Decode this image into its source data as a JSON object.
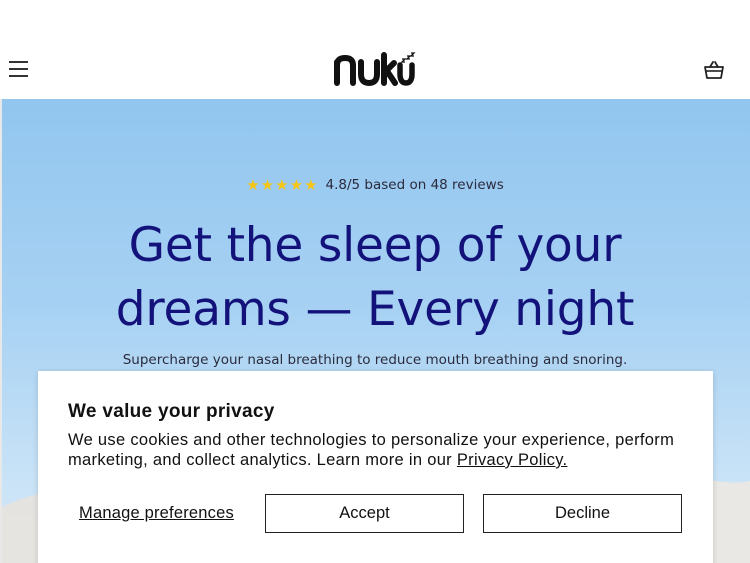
{
  "header": {
    "menu_icon": "hamburger-icon",
    "logo_text": "nukü",
    "cart_icon": "basket-icon"
  },
  "hero": {
    "rating": {
      "stars": 5,
      "star_icon": "star-icon",
      "text": "4.8/5 based on 48 reviews"
    },
    "headline_line1": "Get the sleep of your",
    "headline_line2": "dreams — Every night",
    "subline": "Supercharge your nasal breathing to reduce mouth breathing and snoring."
  },
  "cookie_banner": {
    "title": "We value your privacy",
    "body_text": "We use cookies and other technologies to personalize your experience, perform marketing, and collect analytics. Learn more in our ",
    "policy_link": "Privacy Policy.",
    "manage_label": "Manage preferences",
    "accept_label": "Accept",
    "decline_label": "Decline"
  },
  "colors": {
    "headline": "#13127a",
    "star": "#f5c518",
    "sky_top": "#92c6ef"
  }
}
